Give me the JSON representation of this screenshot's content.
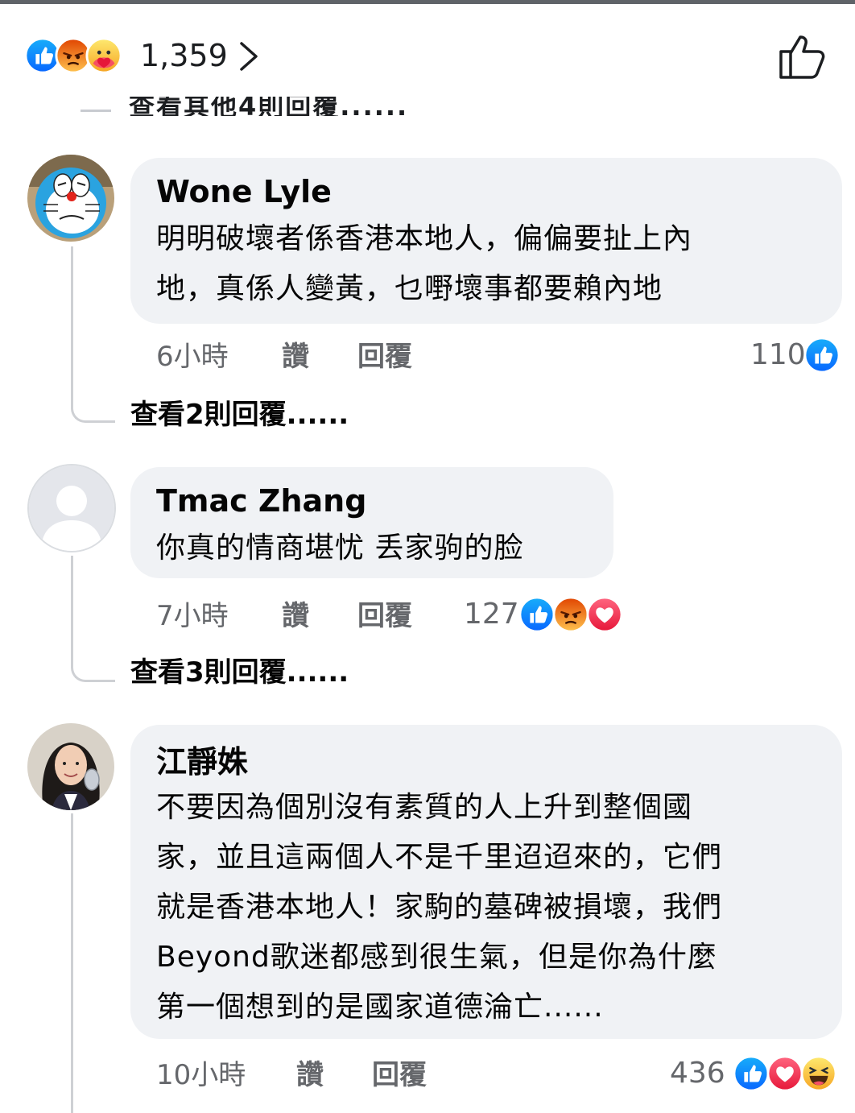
{
  "header": {
    "reaction_count": "1,359",
    "reactions": [
      "like-icon",
      "angry-icon",
      "care-icon"
    ],
    "partial_text": "查看其他4則回覆......"
  },
  "comments": [
    {
      "author": "Wone Lyle",
      "text_lines": [
        "明明破壞者係香港本地人，偏偏要扯上內",
        "地，真係人變黃，乜嘢壞事都要賴內地"
      ],
      "time": "6小時",
      "like_label": "讚",
      "reply_label": "回覆",
      "reaction_count": "110",
      "reactions": [
        "like-icon"
      ],
      "view_replies": "查看2則回覆......"
    },
    {
      "author": "Tmac Zhang",
      "text_lines": [
        "你真的情商堪忧 丢家驹的脸"
      ],
      "time": "7小時",
      "like_label": "讚",
      "reply_label": "回覆",
      "reaction_count": "127",
      "reactions": [
        "like-icon",
        "angry-icon",
        "love-icon"
      ],
      "view_replies": "查看3則回覆......"
    },
    {
      "author": "江靜姝",
      "text_lines": [
        "不要因為個別沒有素質的人上升到整個國",
        "家，並且這兩個人不是千里迢迢來的，它們",
        "就是香港本地人！家駒的墓碑被損壞，我們",
        "Beyond歌迷都感到很生氣，但是你為什麼",
        "第一個想到的是國家道德淪亡......"
      ],
      "time": "10小時",
      "like_label": "讚",
      "reply_label": "回覆",
      "reaction_count": "436",
      "reactions": [
        "like-icon",
        "love-icon",
        "haha-icon"
      ]
    }
  ],
  "colors": {
    "like_blue": "#1877f2",
    "love_red": "#f33e58",
    "angry_orange": "#e9710f",
    "haha_yellow": "#f7b125",
    "bubble_gray": "#f0f2f5",
    "meta_gray": "#65676b"
  }
}
